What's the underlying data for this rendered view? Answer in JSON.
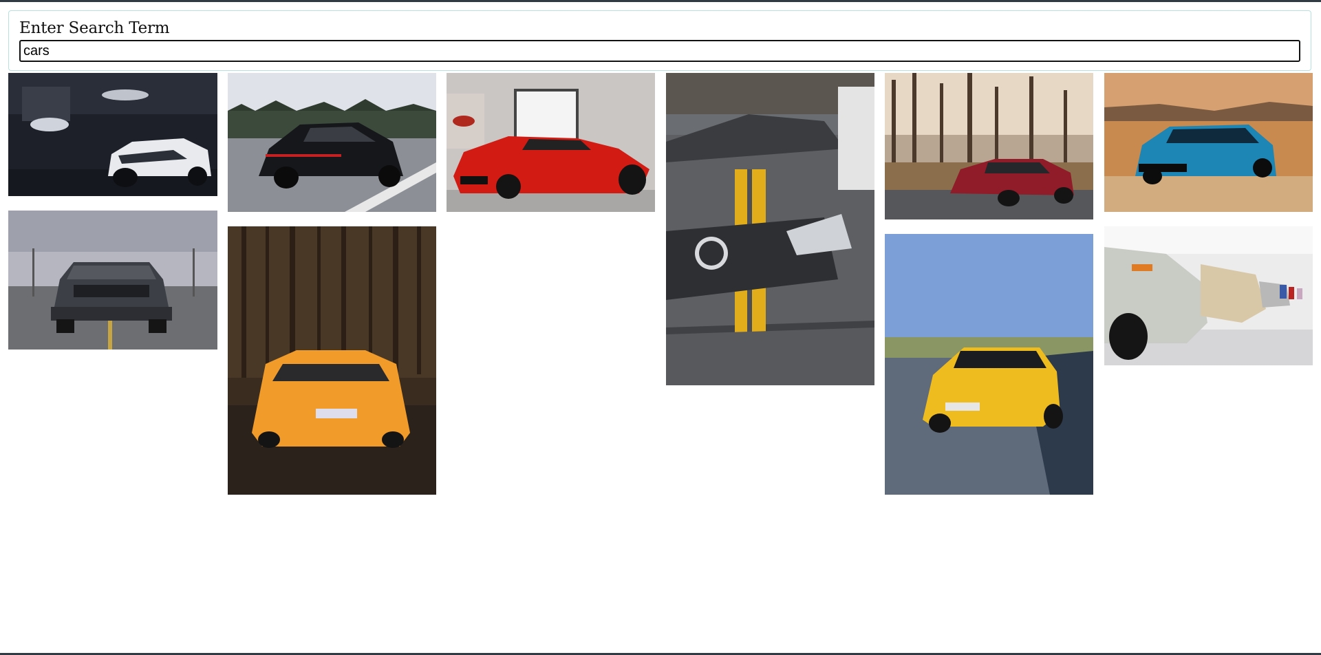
{
  "search": {
    "label": "Enter Search Term",
    "value": "cars"
  },
  "results": [
    {
      "id": "camaro-white",
      "tone": "dark garage"
    },
    {
      "id": "porsche-black",
      "tone": "road"
    },
    {
      "id": "ferrari-red",
      "tone": "showroom"
    },
    {
      "id": "mercedes-grey",
      "tone": "close-up"
    },
    {
      "id": "amg-red",
      "tone": "forest"
    },
    {
      "id": "camaro-blue",
      "tone": "desert"
    },
    {
      "id": "mustang-grey",
      "tone": "lot"
    },
    {
      "id": "lamborghini-orange",
      "tone": "forest"
    },
    {
      "id": "amg-yellow",
      "tone": "road"
    },
    {
      "id": "bmw-row",
      "tone": "museum"
    }
  ]
}
